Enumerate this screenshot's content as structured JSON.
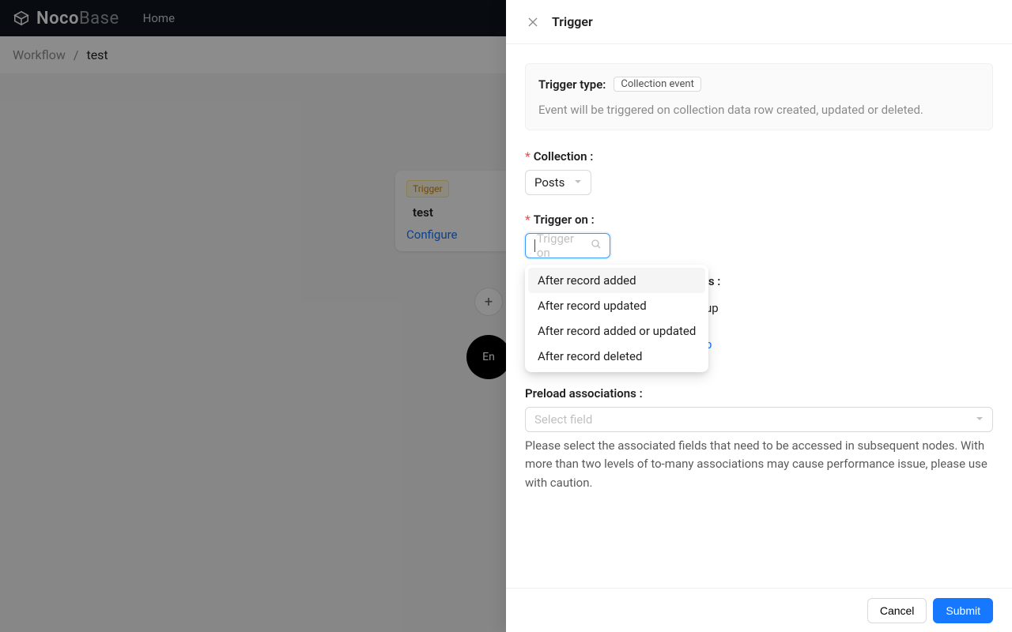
{
  "brand": {
    "name_a": "Noco",
    "name_b": "Base"
  },
  "nav": {
    "home": "Home"
  },
  "breadcrumb": {
    "root": "Workflow",
    "sep": "/",
    "current": "test"
  },
  "canvas": {
    "trigger_badge": "Trigger",
    "node_title": "test",
    "configure": "Configure",
    "plus": "+",
    "end": "En"
  },
  "drawer": {
    "title": "Trigger",
    "trigger_type_label": "Trigger type:",
    "trigger_type_value": "Collection event",
    "trigger_type_desc": "Event will be triggered on collection data row created, updated or deleted.",
    "collection_label": "Collection",
    "collection_value": "Posts",
    "trigger_on_label": "Trigger on",
    "trigger_on_placeholder": "Trigger on",
    "trigger_on_options": [
      "After record added",
      "After record updated",
      "After record added or updated",
      "After record deleted"
    ],
    "partial_ons": "ons :",
    "partial_up": "up",
    "partial_p": "p",
    "preload_label": "Preload associations",
    "preload_placeholder": "Select field",
    "preload_help": "Please select the associated fields that need to be accessed in subsequent nodes. With more than two levels of to-many associations may cause performance issue, please use with caution.",
    "cancel": "Cancel",
    "submit": "Submit"
  }
}
